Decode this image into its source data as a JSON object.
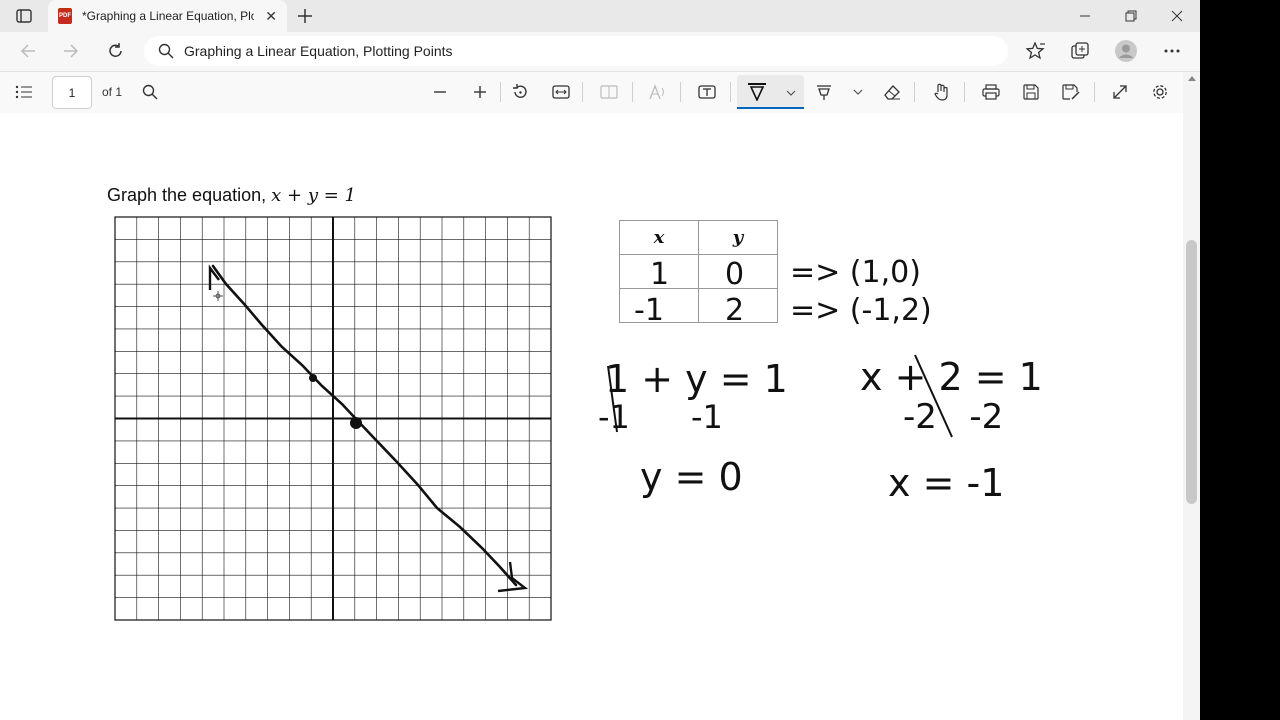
{
  "browser": {
    "tab_title": "*Graphing a Linear Equation, Plo",
    "address": "Graphing a Linear Equation, Plotting Points",
    "pdf_badge": "PDF"
  },
  "pdf_toolbar": {
    "page_number": "1",
    "page_of": "of 1"
  },
  "document": {
    "question_prefix": "Graph the equation,",
    "question_equation": "x + y = 1",
    "table": {
      "headers": [
        "x",
        "y"
      ]
    }
  },
  "annotations": {
    "table_rows": [
      {
        "x": "1",
        "y": "0",
        "point": "=> (1,0)"
      },
      {
        "x": "-1",
        "y": "2",
        "point": "=> (-1,2)"
      }
    ],
    "work_left": [
      "1 + y = 1",
      "-1      -1",
      "y = 0"
    ],
    "work_right": [
      "x + 2 = 1",
      "-2   -2",
      "x = -1"
    ]
  },
  "graph": {
    "x_range": [
      -10,
      10
    ],
    "y_range": [
      -9,
      9
    ],
    "plotted_points": [
      [
        1,
        0
      ],
      [
        -1,
        2
      ]
    ],
    "line_color": "#111111"
  },
  "colors": {
    "ink": "#111111",
    "accent": "#0067c0"
  }
}
